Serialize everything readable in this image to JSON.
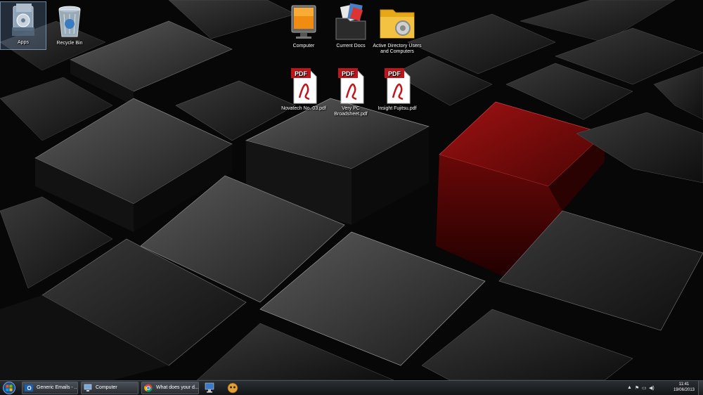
{
  "desktop": {
    "icons": [
      {
        "label": "Apps",
        "icon": "apps-folder-icon"
      },
      {
        "label": "Recycle Bin",
        "icon": "recycle-bin-icon"
      },
      {
        "label": "Computer",
        "icon": "computer-monitor-icon"
      },
      {
        "label": "Current Docs",
        "icon": "documents-folder-icon"
      },
      {
        "label": "Active Directory Users and Computers",
        "icon": "active-directory-gear-icon"
      },
      {
        "label": "Novatech No. 03.pdf",
        "icon": "pdf-icon"
      },
      {
        "label": "Very PC Broadsheet.pdf",
        "icon": "pdf-icon"
      },
      {
        "label": "Insight Fujitsu.pdf",
        "icon": "pdf-icon"
      }
    ],
    "pdf_badge": "PDF"
  },
  "taskbar": {
    "buttons": [
      {
        "label": "Generic Emails - ...",
        "icon": "outlook-icon"
      },
      {
        "label": "Computer",
        "icon": "computer-icon"
      },
      {
        "label": "What does your d...",
        "icon": "chrome-icon"
      }
    ],
    "pinned": [
      "remote-desktop-icon",
      "app-pinned-icon"
    ],
    "clock": {
      "time": "11:41",
      "date": "19/06/2013"
    }
  },
  "colors": {
    "accent_red": "#8b0a0a",
    "pdf_red": "#c0161b",
    "taskbar": "#1b1e22"
  }
}
